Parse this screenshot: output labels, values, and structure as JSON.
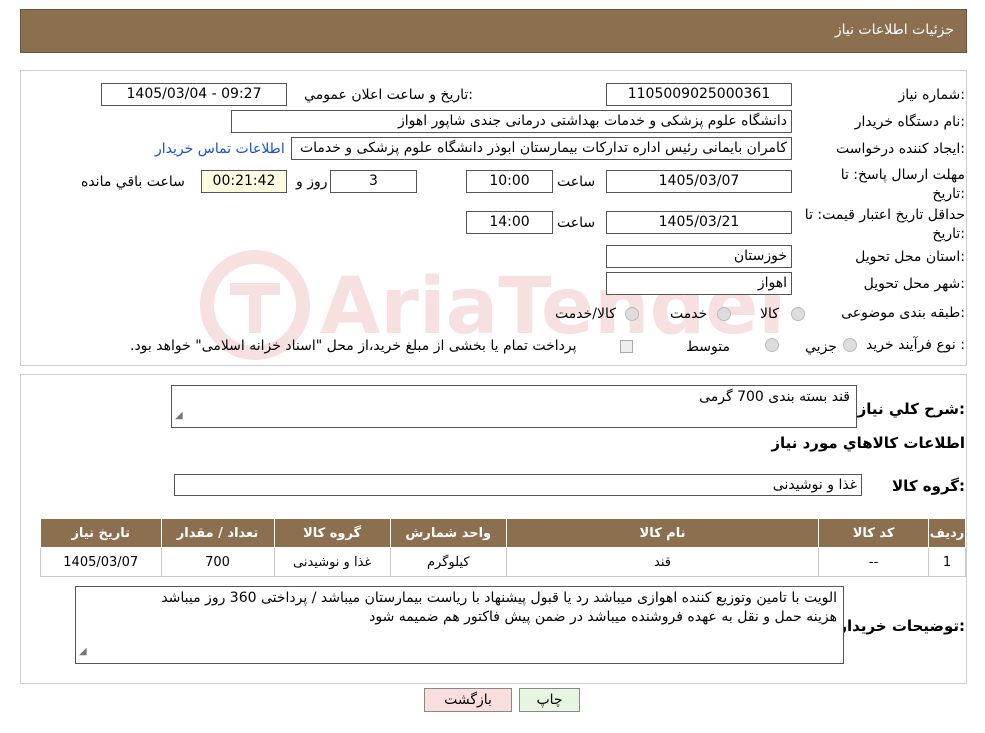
{
  "header": {
    "title": "جزئیات اطلاعات نیاز"
  },
  "form": {
    "need_number_label": "شماره نیاز:",
    "need_number": "1105009025000361",
    "announce_label": "تاریخ و ساعت اعلان عمومي:",
    "announce_value": "1405/03/04 - 09:27",
    "buyer_label": "نام دستگاه خریدار:",
    "buyer_value": "دانشگاه علوم پزشکی و خدمات بهداشتی درمانی جندی شاپور اهواز",
    "creator_label": "ایجاد کننده درخواست:",
    "creator_value": "کامران بایمانی رئیس اداره تدارکات بیمارستان ابوذر  دانشگاه علوم پزشکی و خدمات",
    "contact_link": "اطلاعات تماس خریدار",
    "deadline_label": "مهلت ارسال پاسخ: تا تاریخ:",
    "deadline_date": "1405/03/07",
    "time_word": "ساعت",
    "deadline_time": "10:00",
    "days_value": "3",
    "days_word": "روز و",
    "remaining_value": "00:21:42",
    "remaining_word": "ساعت باقي مانده",
    "validity_label": "حداقل تاریخ اعتبار قیمت: تا تاریخ:",
    "validity_date": "1405/03/21",
    "validity_time": "14:00",
    "province_label": "استان محل تحویل:",
    "province_value": "خوزستان",
    "city_label": "شهر محل تحویل:",
    "city_value": "اهواز",
    "category_label": "طبقه بندی موضوعی:",
    "category_options": [
      "کالا",
      "خدمت",
      "کالا/خدمت"
    ],
    "process_label": "نوع فرآیند خرید :",
    "process_options": [
      "جزيي",
      "متوسط"
    ],
    "process_note": "پرداخت تمام یا بخشی از مبلغ خرید،از محل \"اسناد خزانه اسلامی\" خواهد بود."
  },
  "description": {
    "label": "شرح كلي نياز:",
    "value": "قند بسته بندی 700 گرمی"
  },
  "goods_section_title": "اطلاعات كالاهاي مورد نياز",
  "goods_group": {
    "label": "گروه کالا:",
    "value": "غذا و نوشیدنی"
  },
  "table": {
    "headers": [
      "رديف",
      "كد كالا",
      "نام كالا",
      "واحد شمارش",
      "گروه كالا",
      "تعداد / مقدار",
      "تاريخ نياز"
    ],
    "rows": [
      [
        "1",
        "--",
        "قند",
        "کیلوگرم",
        "غذا و نوشیدنی",
        "700",
        "1405/03/07"
      ]
    ]
  },
  "buyer_notes": {
    "label": "توضیحات خریدار:",
    "line1": "الویت با تامین وتوزیع کننده اهوازی  میباشد رد یا قبول پیشنهاد با ریاست بیمارستان میباشد / پرداختی 360 روز میباشد",
    "line2": "هزینه حمل و نقل به عهده فروشنده میباشد  در ضمن پیش فاکتور هم ضمیمه شود"
  },
  "buttons": {
    "print": "چاپ",
    "back": "بازگشت"
  },
  "watermark": {
    "brand": "AriaTender.neT"
  },
  "colors": {
    "header": "#8b6f4e",
    "link": "#1a4fd6",
    "remaining_bg": "#fffbe0",
    "back_btn": "#f9dede",
    "print_btn": "#e6f5e0"
  }
}
